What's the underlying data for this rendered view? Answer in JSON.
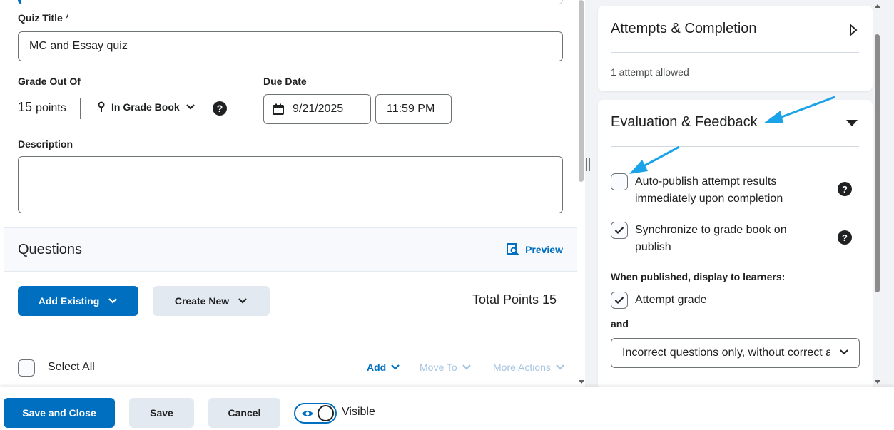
{
  "form": {
    "quiz_title_label": "Quiz Title",
    "quiz_title_required": "*",
    "quiz_title_value": "MC and Essay quiz",
    "grade_label": "Grade Out Of",
    "grade_value": "15",
    "grade_unit": "points",
    "gradebook_label": "In Grade Book",
    "due_date_label": "Due Date",
    "due_date_value": "9/21/2025",
    "due_time_value": "11:59 PM",
    "description_label": "Description",
    "description_value": ""
  },
  "questions": {
    "title": "Questions",
    "preview_label": "Preview",
    "add_existing_label": "Add Existing",
    "create_new_label": "Create New",
    "total_points_label": "Total Points 15",
    "select_all_label": "Select All",
    "add_label": "Add",
    "move_to_label": "Move To",
    "more_actions_label": "More Actions"
  },
  "attempts": {
    "title": "Attempts & Completion",
    "summary": "1 attempt allowed"
  },
  "evaluation": {
    "title": "Evaluation & Feedback",
    "auto_publish_label_line1": "Auto-publish attempt results",
    "auto_publish_label_line2": "immediately upon completion",
    "auto_publish_checked": false,
    "sync_label_line1": "Synchronize to grade book on",
    "sync_label_line2": "publish",
    "sync_checked": true,
    "display_label": "When published, display to learners:",
    "attempt_grade_label": "Attempt grade",
    "attempt_grade_checked": true,
    "and_label": "and",
    "feedback_select_value": "Incorrect questions only, without correct answers"
  },
  "footer": {
    "save_close_label": "Save and Close",
    "save_label": "Save",
    "cancel_label": "Cancel",
    "visible_label": "Visible",
    "visible_on": true
  },
  "colors": {
    "primary": "#006fbf",
    "annotation_arrow": "#1aa3e8"
  }
}
